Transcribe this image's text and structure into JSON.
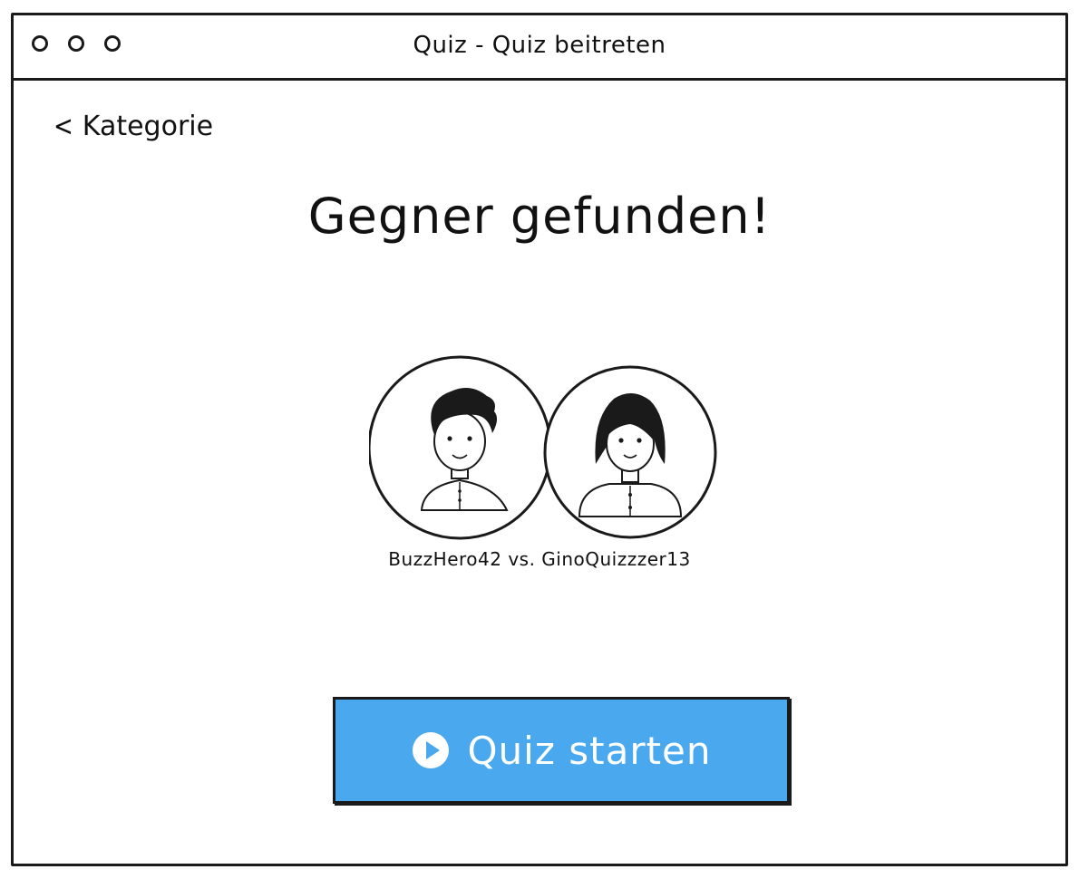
{
  "window": {
    "title": "Quiz - Quiz beitreten"
  },
  "nav": {
    "back_label": "Kategorie",
    "back_icon": "chevron-left-icon"
  },
  "main": {
    "headline": "Gegner gefunden!",
    "players_line": "BuzzHero42 vs. GinoQuizzzer13",
    "avatars": [
      {
        "icon": "male-user-avatar-icon"
      },
      {
        "icon": "female-user-avatar-icon"
      }
    ],
    "start_button": {
      "label": "Quiz starten",
      "icon": "play-circle-icon",
      "color": "#4aa8ee"
    }
  }
}
